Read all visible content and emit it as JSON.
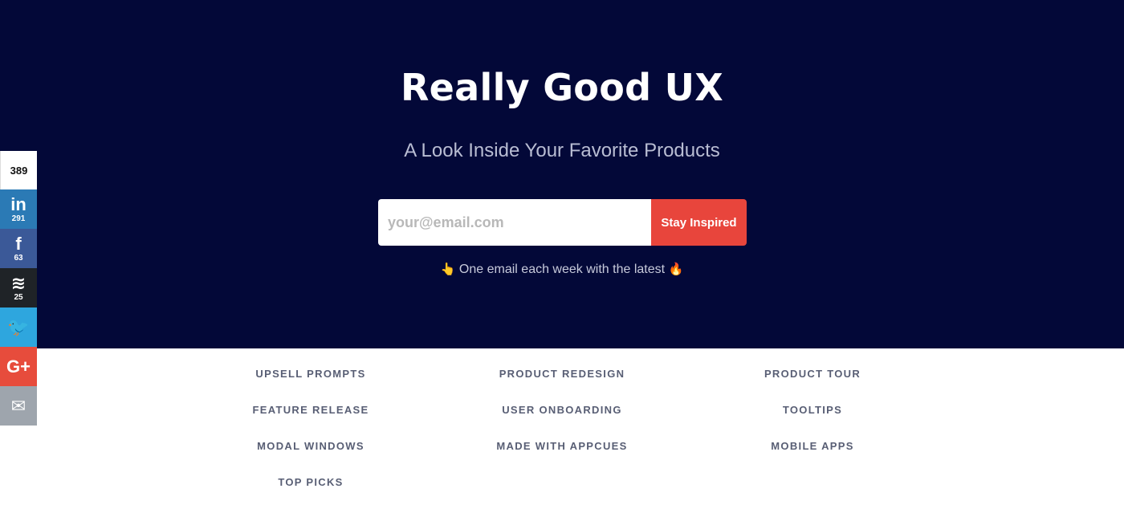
{
  "hero": {
    "title": "Really Good UX",
    "subtitle": "A Look Inside Your Favorite Products",
    "email_placeholder": "your@email.com",
    "subscribe_label": "Stay Inspired",
    "tagline_text": "One email each week with the latest",
    "tagline_emoji_left": "👆",
    "tagline_emoji_right": "🔥",
    "background_color": "#030838",
    "accent_color": "#e8453c"
  },
  "share": {
    "total": "389",
    "buttons": [
      {
        "network": "linkedin",
        "glyph": "in",
        "count": "291",
        "icon": "linkedin-icon"
      },
      {
        "network": "facebook",
        "glyph": "f",
        "count": "63",
        "icon": "facebook-icon"
      },
      {
        "network": "buffer",
        "glyph": "≋",
        "count": "25",
        "icon": "buffer-icon"
      },
      {
        "network": "twitter",
        "glyph": "🐦",
        "count": "",
        "icon": "twitter-icon"
      },
      {
        "network": "googleplus",
        "glyph": "G+",
        "count": "",
        "icon": "google-plus-icon"
      },
      {
        "network": "email",
        "glyph": "✉",
        "count": "",
        "icon": "mail-icon"
      }
    ]
  },
  "nav": {
    "col1": [
      "UPSELL PROMPTS",
      "FEATURE RELEASE",
      "MODAL WINDOWS",
      "TOP PICKS"
    ],
    "col2": [
      "PRODUCT REDESIGN",
      "USER ONBOARDING",
      "MADE WITH APPCUES"
    ],
    "col3": [
      "PRODUCT TOUR",
      "TOOLTIPS",
      "MOBILE APPS"
    ]
  }
}
